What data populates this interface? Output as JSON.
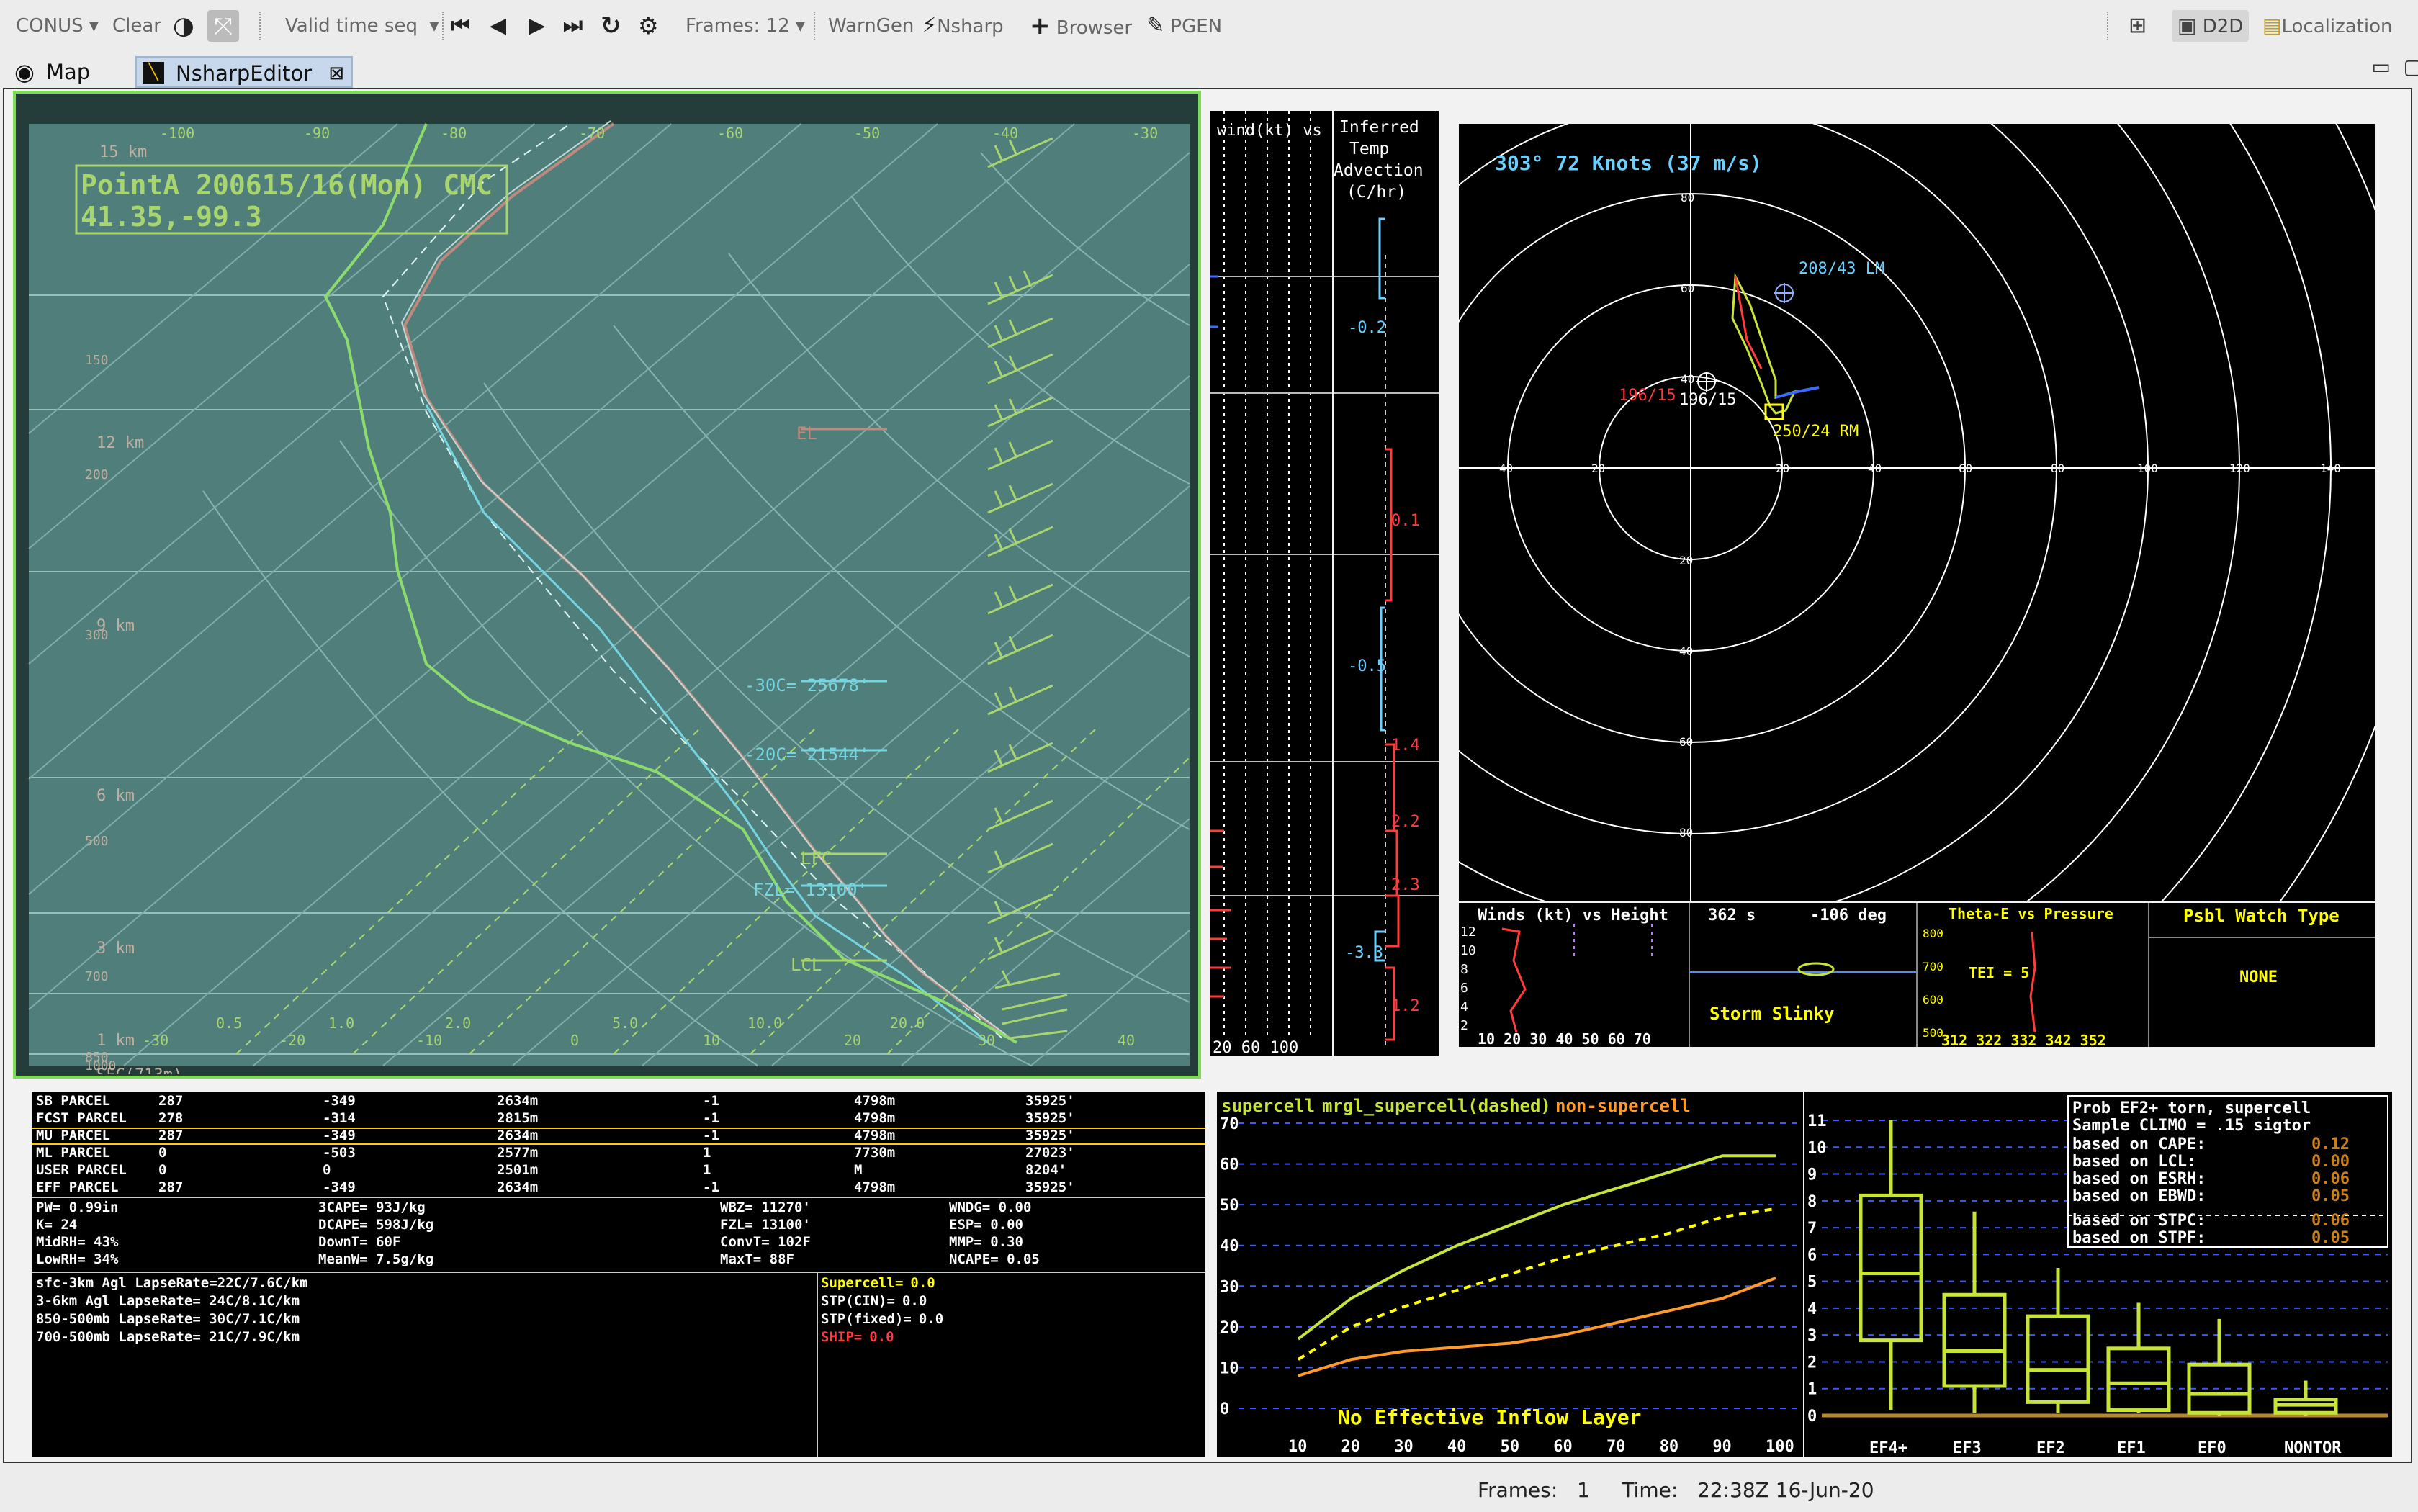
{
  "toolbar": {
    "scale": "CONUS",
    "clear": "Clear",
    "time_seq": "Valid time seq",
    "frames": "Frames: 12",
    "warngen": "WarnGen",
    "nsharp": "Nsharp",
    "browser": "Browser",
    "pgen": "PGEN",
    "d2d": "D2D",
    "localization": "Localization"
  },
  "tabs": [
    {
      "label": "Map"
    },
    {
      "label": "NsharpEditor"
    }
  ],
  "skewt": {
    "title_line1": "PointA 200615/16(Mon) CMC",
    "title_line2": "41.35,-99.3",
    "top_temps": [
      "-100",
      "-90",
      "-80",
      "-70",
      "-60",
      "-50",
      "-40",
      "-30"
    ],
    "bottom_temps": [
      "-30",
      "-20",
      "-10",
      "0",
      "10",
      "20",
      "30",
      "40"
    ],
    "mixing_ratios": [
      "0.5",
      "1.0",
      "2.0",
      "5.0",
      "10.0",
      "20.0"
    ],
    "pressures": [
      "150",
      "200",
      "300",
      "500",
      "700",
      "850",
      "1000"
    ],
    "heights": [
      "15 km",
      "12 km",
      "9 km",
      "6 km",
      "3 km",
      "1 km",
      "SFC(713m)"
    ],
    "el": "EL",
    "lfc": "LFC",
    "lcl": "LCL",
    "m30c": "-30C= 25678'",
    "m20c": "-20C= 21544'",
    "fzl": "FZL= 13100'"
  },
  "wind_panel": {
    "title": "wind(kt) vs Ht",
    "axis": "20 60 100"
  },
  "advection": {
    "title": "Inferred Temp Advection (C/hr)",
    "values": [
      {
        "v": "-0.2",
        "color": "#6ad0ff"
      },
      {
        "v": "0.1",
        "color": "#ff3b3b"
      },
      {
        "v": "-0.5",
        "color": "#6ad0ff"
      },
      {
        "v": "1.4",
        "color": "#ff3b3b"
      },
      {
        "v": "2.2",
        "color": "#ff3b3b"
      },
      {
        "v": "2.3",
        "color": "#ff3b3b"
      },
      {
        "v": "-3.3",
        "color": "#6ad0ff"
      },
      {
        "v": "1.2",
        "color": "#ff3b3b"
      }
    ]
  },
  "hodograph": {
    "header": "303°  72 Knots (37 m/s)",
    "lm": "208/43 LM",
    "mean_red": "196/15",
    "mean_white": "196/15",
    "rm": "250/24 RM",
    "ring_labels": [
      "80",
      "60",
      "40",
      "20",
      "20",
      "40",
      "60",
      "80"
    ],
    "x_labels": [
      "40",
      "20",
      "20",
      "40",
      "60",
      "80",
      "100",
      "120",
      "140"
    ]
  },
  "insets": {
    "winds_title": "Winds (kt) vs Height",
    "winds_y": [
      "12",
      "10",
      "8",
      "6",
      "4",
      "2"
    ],
    "winds_x": "10 20 30 40 50 60 70",
    "slinky_time": "362 s",
    "slinky_deg": "-106 deg",
    "slinky_label": "Storm Slinky",
    "theta_title": "Theta-E vs Pressure",
    "theta_p": [
      "800",
      "700",
      "600",
      "500"
    ],
    "tei": "TEI = 5",
    "theta_x": "312  322  332  342  352",
    "psbl_title": "Psbl Watch Type",
    "psbl_value": "NONE"
  },
  "parcels": [
    [
      "SB PARCEL",
      "287",
      "-349",
      "2634m",
      "-1",
      "4798m",
      "35925'"
    ],
    [
      "FCST PARCEL",
      "278",
      "-314",
      "2815m",
      "-1",
      "4798m",
      "35925'"
    ],
    [
      "MU PARCEL",
      "287",
      "-349",
      "2634m",
      "-1",
      "4798m",
      "35925'"
    ],
    [
      "ML PARCEL",
      "0",
      "-503",
      "2577m",
      "1",
      "7730m",
      "27023'"
    ],
    [
      "USER PARCEL",
      "0",
      "0",
      "2501m",
      "1",
      "M",
      "8204'"
    ],
    [
      "EFF PARCEL",
      "287",
      "-349",
      "2634m",
      "-1",
      "4798m",
      "35925'"
    ]
  ],
  "indices": [
    [
      "PW=  0.99in",
      "3CAPE= 93J/kg",
      "WBZ=  11270'",
      "WNDG=  0.00"
    ],
    [
      "K=   24",
      "DCAPE= 598J/kg",
      "FZL=  13100'",
      "ESP=   0.00"
    ],
    [
      "MidRH=  43%",
      "DownT= 60F",
      "ConvT= 102F",
      "MMP=   0.30"
    ],
    [
      "LowRH=  34%",
      "MeanW= 7.5g/kg",
      "MaxT=  88F",
      "NCAPE= 0.05"
    ]
  ],
  "lapse": [
    "sfc-3km Agl LapseRate=22C/7.6C/km",
    "3-6km Agl LapseRate=  24C/8.1C/km",
    "850-500mb LapseRate=  30C/7.1C/km",
    "700-500mb LapseRate=  21C/7.9C/km"
  ],
  "stp": [
    {
      "label": "Supercell=",
      "value": "0.0",
      "color": "#ffff00"
    },
    {
      "label": "STP(CIN)=",
      "value": "0.0",
      "color": "#ffffff"
    },
    {
      "label": "STP(fixed)=",
      "value": "0.0",
      "color": "#ffffff"
    },
    {
      "label": "SHIP=",
      "value": "0.0",
      "color": "#ff3b3b"
    }
  ],
  "supercell_chart": {
    "legend_a": "supercell",
    "legend_b": "mrgl_supercell(dashed)",
    "legend_c": "non-supercell",
    "y_labels": [
      "70",
      "60",
      "50",
      "40",
      "30",
      "20",
      "10",
      "0"
    ],
    "x_labels": [
      "10",
      "20",
      "30",
      "40",
      "50",
      "60",
      "70",
      "80",
      "90",
      "100"
    ],
    "message": "No Effective Inflow Layer"
  },
  "chart_data": {
    "type": "line",
    "x": [
      10,
      20,
      30,
      40,
      50,
      60,
      70,
      80,
      90,
      100
    ],
    "ylim": [
      0,
      70
    ],
    "series": [
      {
        "name": "supercell",
        "values": [
          17,
          27,
          34,
          40,
          45,
          50,
          54,
          58,
          62,
          62
        ]
      },
      {
        "name": "mrgl_supercell(dashed)",
        "values": [
          12,
          20,
          25,
          29,
          33,
          37,
          40,
          43,
          47,
          49
        ]
      },
      {
        "name": "non-supercell",
        "values": [
          8,
          12,
          14,
          15,
          16,
          18,
          21,
          24,
          27,
          32
        ]
      }
    ]
  },
  "box_chart": {
    "y_labels": [
      "11",
      "10",
      "9",
      "8",
      "7",
      "6",
      "5",
      "4",
      "3",
      "2",
      "1",
      "0"
    ],
    "categories": [
      "EF4+",
      "EF3",
      "EF2",
      "EF1",
      "EF0",
      "NONTOR"
    ],
    "boxes": [
      {
        "whisker_hi": 11,
        "q3": 8.2,
        "med": 5.3,
        "q1": 2.8,
        "whisker_lo": 0.2
      },
      {
        "whisker_hi": 7.6,
        "q3": 4.5,
        "med": 2.4,
        "q1": 1.1,
        "whisker_lo": 0.1
      },
      {
        "whisker_hi": 5.5,
        "q3": 3.7,
        "med": 1.7,
        "q1": 0.5,
        "whisker_lo": 0.1
      },
      {
        "whisker_hi": 4.2,
        "q3": 2.5,
        "med": 1.2,
        "q1": 0.2,
        "whisker_lo": 0.1
      },
      {
        "whisker_hi": 3.6,
        "q3": 1.9,
        "med": 0.8,
        "q1": 0.1,
        "whisker_lo": 0.0
      },
      {
        "whisker_hi": 1.3,
        "q3": 0.6,
        "med": 0.4,
        "q1": 0.1,
        "whisker_lo": 0.0
      }
    ],
    "prob_title1": "Prob EF2+ torn, supercell",
    "prob_title2": "Sample CLIMO = .15 sigtor",
    "prob_rows": [
      {
        "label": "based on CAPE:",
        "value": "0.12"
      },
      {
        "label": "based on LCL:",
        "value": "0.00"
      },
      {
        "label": "based on ESRH:",
        "value": "0.06"
      },
      {
        "label": "based on EBWD:",
        "value": "0.05"
      },
      {
        "label": "based on STPC:",
        "value": "0.06"
      },
      {
        "label": "based on STPF:",
        "value": "0.05"
      }
    ]
  },
  "status": {
    "frames_label": "Frames:",
    "frames_value": "1",
    "time_label": "Time:",
    "time_value": "22:38Z 16-Jun-20"
  }
}
